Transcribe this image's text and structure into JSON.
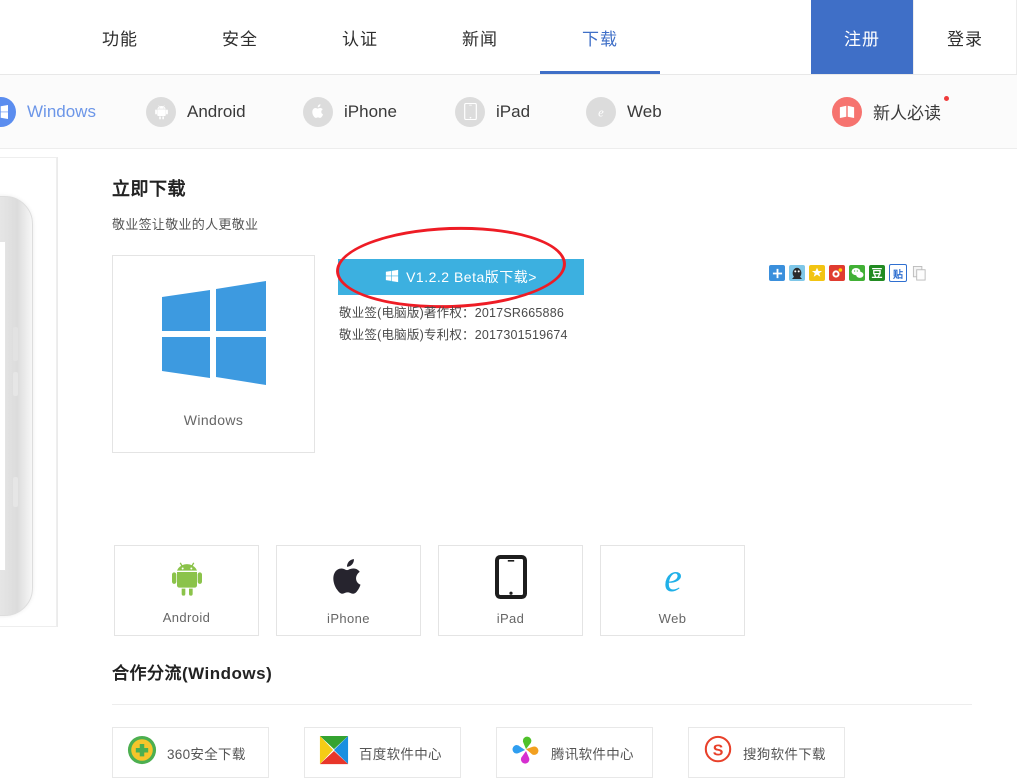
{
  "topnav": {
    "items": [
      {
        "label": "功能",
        "active": false
      },
      {
        "label": "安全",
        "active": false
      },
      {
        "label": "认证",
        "active": false
      },
      {
        "label": "新闻",
        "active": false
      },
      {
        "label": "下载",
        "active": true
      }
    ],
    "register_label": "注册",
    "login_label": "登录",
    "active_color": "#3f6fc7",
    "register_bg": "#3f6fc7"
  },
  "platformbar": {
    "tabs": [
      {
        "label": "Windows",
        "icon": "windows-icon",
        "active": true
      },
      {
        "label": "Android",
        "icon": "android-icon",
        "active": false
      },
      {
        "label": "iPhone",
        "icon": "apple-icon",
        "active": false
      },
      {
        "label": "iPad",
        "icon": "tablet-icon",
        "active": false
      },
      {
        "label": "Web",
        "icon": "ie-icon",
        "active": false
      }
    ],
    "newbie_label": "新人必读",
    "newbie_icon": "book-icon",
    "active_color": "#6c96e8",
    "badge_color": "#ef3b3b"
  },
  "download": {
    "title": "立即下载",
    "subtitle": "敬业签让敬业的人更敬业",
    "button_label": "V1.2.2 Beta版下载>",
    "button_icon": "windows-logo-icon",
    "button_color": "#3cb0e0",
    "copyright_line1": "敬业签(电脑版)著作权：2017SR665886",
    "copyright_line2": "敬业签(电脑版)专利权：2017301519674",
    "annotation_color": "#ee1c25",
    "windows_card_label": "Windows",
    "platform_cards": [
      {
        "label": "Android",
        "icon": "android-icon"
      },
      {
        "label": "iPhone",
        "icon": "apple-icon"
      },
      {
        "label": "iPad",
        "icon": "tablet-icon"
      },
      {
        "label": "Web",
        "icon": "ie-icon"
      }
    ],
    "share_icons": [
      {
        "name": "share-plus-icon",
        "glyph": "+"
      },
      {
        "name": "qq-icon",
        "glyph": ""
      },
      {
        "name": "qzone-icon",
        "glyph": "★"
      },
      {
        "name": "weibo-icon",
        "glyph": ""
      },
      {
        "name": "wechat-icon",
        "glyph": ""
      },
      {
        "name": "douban-icon",
        "glyph": "豆"
      },
      {
        "name": "tieba-icon",
        "glyph": "贴"
      },
      {
        "name": "copy-icon",
        "glyph": ""
      }
    ]
  },
  "partners": {
    "title": "合作分流(Windows)",
    "items": [
      {
        "label": "360安全下载",
        "icon": "360-icon"
      },
      {
        "label": "百度软件中心",
        "icon": "baidu-icon"
      },
      {
        "label": "腾讯软件中心",
        "icon": "tencent-icon"
      },
      {
        "label": "搜狗软件下载",
        "icon": "sogou-icon"
      }
    ]
  }
}
